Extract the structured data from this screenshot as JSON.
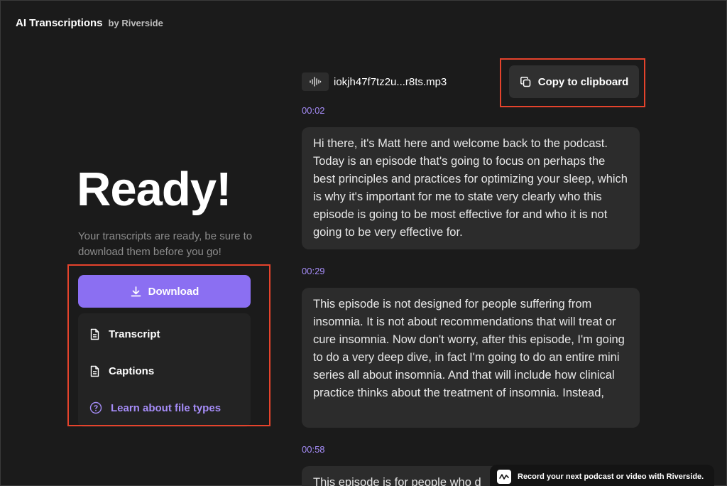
{
  "header": {
    "title": "AI Transcriptions",
    "by_line": "by Riverside"
  },
  "left": {
    "heading": "Ready!",
    "description": "Your transcripts are ready, be sure to download them before you go!",
    "download_label": "Download",
    "menu": {
      "transcript_label": "Transcript",
      "captions_label": "Captions",
      "learn_label": "Learn about file types"
    }
  },
  "file": {
    "name": "iokjh47f7tz2u...r8ts.mp3",
    "icon": "audio-waveform-icon"
  },
  "toolbar": {
    "copy_label": "Copy to clipboard"
  },
  "transcript": [
    {
      "time": "00:02",
      "text": "Hi there, it's Matt here and welcome back to the podcast. Today is an episode that's going to focus on perhaps the best principles and practices for optimizing your sleep, which is why it's important for me to state very clearly who this episode is going to be most effective for and who it is not going to be very effective for."
    },
    {
      "time": "00:29",
      "text": "This episode is not designed for people suffering from insomnia. It is not about recommendations that will treat or cure insomnia. Now don't worry, after this episode, I'm going to do a very deep dive, in fact I'm going to do an entire mini series all about insomnia. And that will include how clinical practice thinks about the treatment of insomnia. Instead,"
    },
    {
      "time": "00:58",
      "text": "This episode is for people who d"
    }
  ],
  "promo": {
    "text": "Record your next podcast or video with Riverside."
  },
  "colors": {
    "background": "#1b1b1b",
    "accent": "#8b6ff2",
    "timestamp": "#a58cf7",
    "bubble": "#2c2c2c",
    "highlight": "#e5432c"
  }
}
